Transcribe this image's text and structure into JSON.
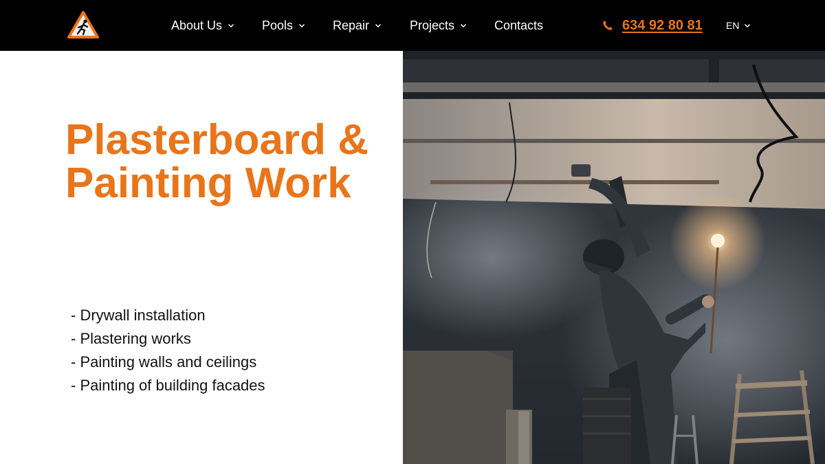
{
  "nav": {
    "items": [
      {
        "label": "About Us",
        "has_dropdown": true
      },
      {
        "label": "Pools",
        "has_dropdown": true
      },
      {
        "label": "Repair",
        "has_dropdown": true
      },
      {
        "label": "Projects",
        "has_dropdown": true
      },
      {
        "label": "Contacts",
        "has_dropdown": false
      }
    ],
    "phone": "634 92 80 81",
    "language": "EN"
  },
  "main": {
    "title_line1": "Plasterboard &",
    "title_line2": "Painting Work",
    "services": [
      "- Drywall installation",
      "- Plastering works",
      "- Painting walls and ceilings",
      "- Painting of building facades"
    ]
  },
  "colors": {
    "accent": "#e8751a",
    "navbar": "#000000"
  },
  "icons": {
    "logo": "warning-triangle-worker-icon",
    "phone": "phone-icon",
    "dropdown": "chevron-down-icon"
  }
}
